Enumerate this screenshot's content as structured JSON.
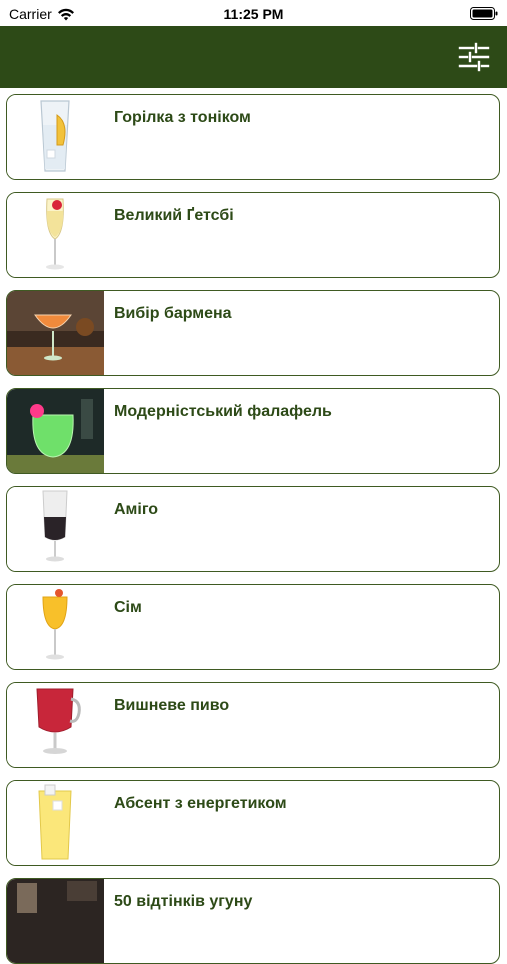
{
  "status_bar": {
    "carrier": "Carrier",
    "time": "11:25 PM"
  },
  "nav": {
    "filter_icon": "sliders-icon"
  },
  "colors": {
    "nav_background": "#2d4a17",
    "accent": "#3f5a22",
    "title": "#2d4a17"
  },
  "cocktails": [
    {
      "name": "Горілка з тоніком",
      "image": "highball-glass-lemon"
    },
    {
      "name": "Великий Ґетсбі",
      "image": "flute-glass-cherry"
    },
    {
      "name": "Вибір бармена",
      "image": "coupe-glass-orange-bar"
    },
    {
      "name": "Модерністський фалафель",
      "image": "green-glass-bar"
    },
    {
      "name": "Аміго",
      "image": "layered-shot-dark"
    },
    {
      "name": "Сім",
      "image": "orange-cocktail-glass"
    },
    {
      "name": "Вишневе пиво",
      "image": "red-mug-glass"
    },
    {
      "name": "Абсент з енергетиком",
      "image": "yellow-highball-glass"
    },
    {
      "name": "50 відтінків угуну",
      "image": "dark-bar-glass"
    }
  ]
}
